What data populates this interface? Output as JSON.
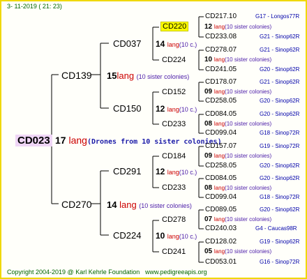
{
  "header": {
    "date": "3- 11-2019 ( 21: 23)"
  },
  "footer": {
    "copyright": "Copyright 2004-2019 @ Karl Kehrle Foundation",
    "site": "www.pedigreeapis.org"
  },
  "root": {
    "id": "CD023",
    "num": "17",
    "lang": "lang",
    "note": "(Drones from 10 sister colonies)"
  },
  "gen1": {
    "top": {
      "id": "CD139",
      "num": "15",
      "lang": "lang",
      "note": "(10 sister colonies)"
    },
    "bottom": {
      "id": "CD270",
      "num": "14",
      "lang": "lang",
      "note": "(10 sister colonies)"
    }
  },
  "gen2": [
    {
      "id": "CD037",
      "num": "14",
      "lang": "lang",
      "note": "(10 c.)"
    },
    {
      "id": "CD150",
      "num": "12",
      "lang": "lang",
      "note": "(10 c.)"
    },
    {
      "id": "CD291",
      "num": "12",
      "lang": "lang",
      "note": "(10 c.)"
    },
    {
      "id": "CD224",
      "num": "10",
      "lang": "lang",
      "note": "(10 c.)"
    }
  ],
  "gen3": [
    {
      "id": "CD220",
      "num": "12",
      "lang": "lang",
      "note": "(10 sister colonies)"
    },
    {
      "id": "CD224",
      "num": "10",
      "lang": "lang",
      "note": "(10 sister colonies)"
    },
    {
      "id": "CD152",
      "num": "09",
      "lang": "lang",
      "note": "(10 sister colonies)"
    },
    {
      "id": "CD233",
      "num": "08",
      "lang": "lang",
      "note": "(10 sister colonies)"
    },
    {
      "id": "CD184",
      "num": "09",
      "lang": "lang",
      "note": "(10 sister colonies)"
    },
    {
      "id": "CD233",
      "num": "08",
      "lang": "lang",
      "note": "(10 sister colonies)"
    },
    {
      "id": "CD278",
      "num": "07",
      "lang": "lang",
      "note": "(10 sister colonies)"
    },
    {
      "id": "CD241",
      "num": "05",
      "lang": "lang",
      "note": "(10 sister colonies)"
    }
  ],
  "gen4": [
    {
      "id": "CD217.10",
      "code": "G17 - Longos77R"
    },
    {
      "id": "CD233.08",
      "code": "G21 - Sinop62R"
    },
    {
      "id": "CD278.07",
      "code": "G21 - Sinop62R"
    },
    {
      "id": "CD241.05",
      "code": "G20 - Sinop62R"
    },
    {
      "id": "CD178.07",
      "code": "G21 - Sinop62R"
    },
    {
      "id": "CD258.05",
      "code": "G20 - Sinop62R"
    },
    {
      "id": "CD084.05",
      "code": "G20 - Sinop62R"
    },
    {
      "id": "CD099.04",
      "code": "G18 - Sinop72R"
    },
    {
      "id": "CD157.07",
      "code": "G19 - Sinop72R"
    },
    {
      "id": "CD258.05",
      "code": "G20 - Sinop62R"
    },
    {
      "id": "CD084.05",
      "code": "G20 - Sinop62R"
    },
    {
      "id": "CD099.04",
      "code": "G18 - Sinop72R"
    },
    {
      "id": "CD089.05",
      "code": "G20 - Sinop62R"
    },
    {
      "id": "CD240.03",
      "code": "G4 - Caucas98R"
    },
    {
      "id": "CD128.02",
      "code": "G19 - Sinop62R"
    },
    {
      "id": "CD053.01",
      "code": "G16 - Sinop72R"
    }
  ]
}
